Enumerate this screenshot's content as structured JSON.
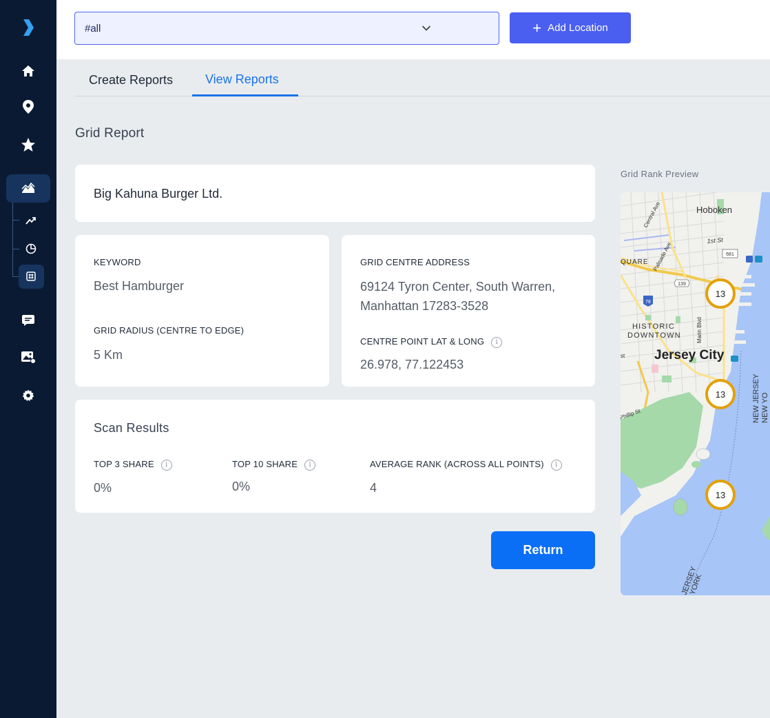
{
  "sidebar": {
    "logo_icon": "chevron-right-logo",
    "items": [
      {
        "icon": "home-icon"
      },
      {
        "icon": "location-pin-icon"
      },
      {
        "icon": "star-icon"
      },
      {
        "icon": "reports-icon",
        "active": true
      },
      {
        "icon": "trend-icon"
      },
      {
        "icon": "pie-chart-icon"
      },
      {
        "icon": "grid-icon",
        "active": true
      },
      {
        "icon": "message-icon"
      },
      {
        "icon": "image-icon"
      },
      {
        "icon": "gear-icon"
      }
    ]
  },
  "topbar": {
    "select_value": "#all",
    "add_button_label": "Add Location"
  },
  "tabs": [
    {
      "label": "Create Reports",
      "active": false
    },
    {
      "label": "View Reports",
      "active": true
    }
  ],
  "section_title": "Grid Report",
  "business_name": "Big Kahuna Burger Ltd.",
  "keyword": {
    "label": "KEYWORD",
    "value": "Best Hamburger"
  },
  "grid_radius": {
    "label": "GRID RADIUS (CENTRE TO EDGE)",
    "value": "5 Km"
  },
  "grid_centre_address": {
    "label": "GRID CENTRE ADDRESS",
    "line1": "69124 Tyron Center, South Warren,",
    "line2": "Manhattan 17283-3528"
  },
  "centre_point": {
    "label": "CENTRE POINT LAT & LONG",
    "value": "26.978,  77.122453"
  },
  "scan_results": {
    "title": "Scan Results",
    "top3": {
      "label": "TOP 3 SHARE",
      "value": "0%"
    },
    "top10": {
      "label": "TOP 10 SHARE",
      "value": "0%"
    },
    "average": {
      "label": "AVERAGE RANK (ACROSS ALL POINTS)",
      "value": "4"
    }
  },
  "return_label": "Return",
  "preview": {
    "label": "Grid Rank Preview",
    "markers": [
      "13",
      "13",
      "13"
    ],
    "map_labels": {
      "hoboken": "Hoboken",
      "first_st": "1st St",
      "central_ave": "Central Ave",
      "palisade_ave": "Palisade Ave",
      "square": "QUARE",
      "historic": "HISTORIC",
      "downtown": "DOWNTOWN",
      "marin_blvd": "Marin Blvd",
      "jersey_city": "Jersey City",
      "new_jersey": "NEW JERSEY",
      "new_york": "NEW YO",
      "phillip_st": "Phillip St",
      "st": "st",
      "jersey_bottom": "JERSEY",
      "york_bottom": "YORK",
      "shield_139": "139",
      "shield_78": "78",
      "shield_681": "681"
    },
    "colors": {
      "water": "#a7c5f7",
      "park": "#a6d9a9",
      "marker": "#e3a008"
    }
  }
}
